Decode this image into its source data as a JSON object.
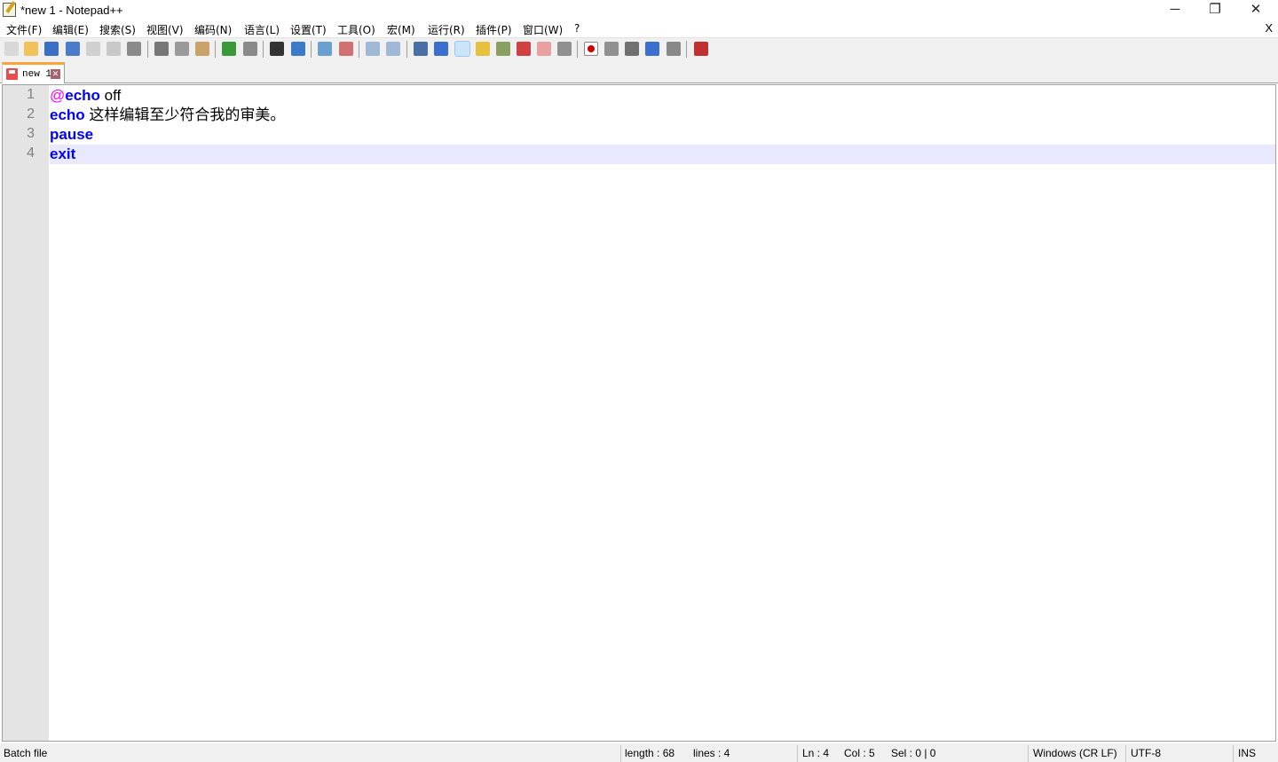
{
  "window": {
    "title": "*new 1 - Notepad++",
    "minimize": "─",
    "restore": "❐",
    "close": "✕"
  },
  "menu": {
    "items": [
      "文件(F)",
      "编辑(E)",
      "搜索(S)",
      "视图(V)",
      "编码(N)",
      "语言(L)",
      "设置(T)",
      "工具(O)",
      "宏(M)",
      "运行(R)",
      "插件(P)",
      "窗口(W)",
      "?"
    ],
    "close": "X"
  },
  "toolbar": {
    "icons": [
      "new-file-icon",
      "open-file-icon",
      "save-icon",
      "save-all-icon",
      "close-icon",
      "close-all-icon",
      "print-icon",
      "cut-icon",
      "copy-icon",
      "paste-icon",
      "undo-icon",
      "redo-icon",
      "find-icon",
      "replace-icon",
      "zoom-in-icon",
      "zoom-out-icon",
      "sync-vertical-icon",
      "sync-horizontal-icon",
      "word-wrap-icon",
      "show-all-chars-icon",
      "indent-guide-icon",
      "udl-icon",
      "document-map-icon",
      "function-list-icon",
      "folder-as-workspace-icon",
      "monitoring-icon",
      "record-macro-icon",
      "stop-record-icon",
      "play-macro-icon",
      "run-macro-multiple-icon",
      "save-macro-icon",
      "spell-check-icon"
    ],
    "colors": [
      "#d8d8d8",
      "#f2c25a",
      "#3b6fc4",
      "#4a7cc9",
      "#d0d0d0",
      "#c8c8c8",
      "#8a8a8a",
      "#777",
      "#9a9a9a",
      "#c9a36a",
      "#3a9a3a",
      "#8a8a8a",
      "#333",
      "#3a7ac9",
      "#6aa0d0",
      "#d07070",
      "#a0b8d8",
      "#a0b8d8",
      "#4a6fa5",
      "#3a6fd0",
      "#1e50c0",
      "#e8c040",
      "#8aa060",
      "#d04040",
      "#e8a0a0",
      "#909090",
      "#c00000",
      "#909090",
      "#707070",
      "#3a6fd0",
      "#888",
      "#c03030"
    ],
    "active_index": 20
  },
  "tab": {
    "label": "new 1",
    "close": "✕"
  },
  "editor": {
    "lines": [
      {
        "num": "1",
        "parts": [
          {
            "t": "@",
            "c": "at"
          },
          {
            "t": "echo",
            "c": "kw"
          },
          {
            "t": " off",
            "c": ""
          }
        ]
      },
      {
        "num": "2",
        "parts": [
          {
            "t": "echo",
            "c": "kw"
          },
          {
            "t": " 这样编辑至少符合我的审美。",
            "c": ""
          }
        ]
      },
      {
        "num": "3",
        "parts": [
          {
            "t": "pause",
            "c": "kw"
          }
        ]
      },
      {
        "num": "4",
        "parts": [
          {
            "t": "exit",
            "c": "kw"
          }
        ]
      }
    ],
    "current_line": 4
  },
  "status": {
    "type": "Batch file",
    "length": "length : 68",
    "lines": "lines : 4",
    "ln": "Ln : 4",
    "col": "Col : 5",
    "sel": "Sel : 0 | 0",
    "eol": "Windows (CR LF)",
    "encoding": "UTF-8",
    "mode": "INS"
  }
}
